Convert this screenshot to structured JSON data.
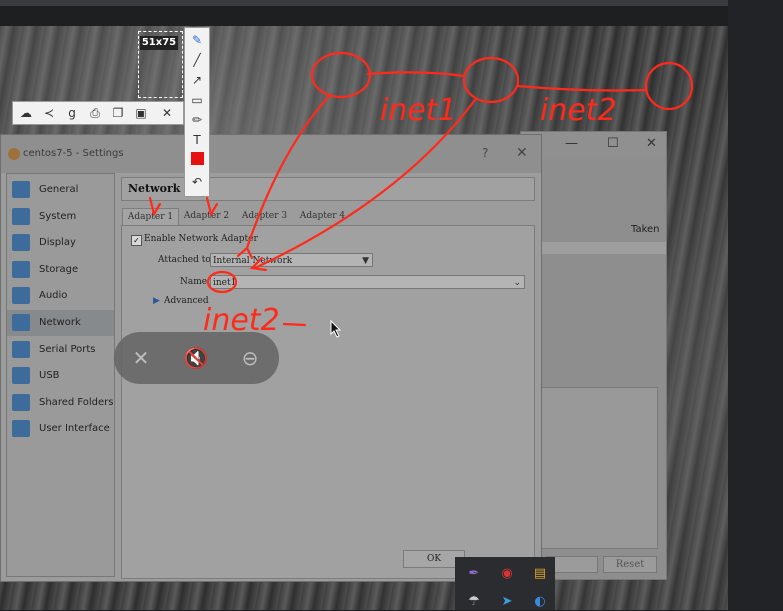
{
  "selection": {
    "size_label": "51x75"
  },
  "dialog": {
    "title": "centos7-5 - Settings",
    "help_label": "?",
    "close_label": "✕",
    "sidebar": [
      {
        "label": "General",
        "icon": "general-icon",
        "selected": false
      },
      {
        "label": "System",
        "icon": "system-icon",
        "selected": false
      },
      {
        "label": "Display",
        "icon": "display-icon",
        "selected": false
      },
      {
        "label": "Storage",
        "icon": "storage-icon",
        "selected": false
      },
      {
        "label": "Audio",
        "icon": "audio-icon",
        "selected": false
      },
      {
        "label": "Network",
        "icon": "network-icon",
        "selected": true
      },
      {
        "label": "Serial Ports",
        "icon": "serial-ports-icon",
        "selected": false
      },
      {
        "label": "USB",
        "icon": "usb-icon",
        "selected": false
      },
      {
        "label": "Shared Folders",
        "icon": "shared-folders-icon",
        "selected": false
      },
      {
        "label": "User Interface",
        "icon": "user-interface-icon",
        "selected": false
      }
    ],
    "page_title": "Network",
    "tabs": [
      "Adapter 1",
      "Adapter 2",
      "Adapter 3",
      "Adapter 4"
    ],
    "active_tab": 0,
    "enable_label": "Enable Network Adapter",
    "attached_label": "Attached to:",
    "attached_value": "Internal Network",
    "name_label": "Name:",
    "name_value": "inet1",
    "advanced_label": "Advanced",
    "ok_label": "OK"
  },
  "manager": {
    "minimize": "—",
    "maximize": "☐",
    "close": "✕",
    "taken_header": "Taken",
    "btn_right": "Reset"
  },
  "annotations": [
    "inet1",
    "inet2",
    "inet2"
  ],
  "colors": {
    "annotation": "#ff2a1a",
    "accent": "#3d6b9a"
  }
}
